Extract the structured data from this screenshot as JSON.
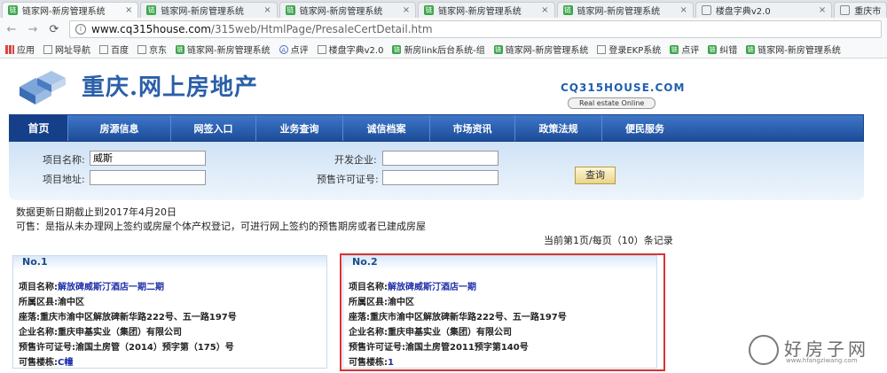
{
  "browser": {
    "tabs": [
      {
        "label": "链家网-新房管理系统",
        "icon": "green",
        "active": true
      },
      {
        "label": "链家网-新房管理系统",
        "icon": "green",
        "active": false
      },
      {
        "label": "链家网-新房管理系统",
        "icon": "green",
        "active": false
      },
      {
        "label": "链家网-新房管理系统",
        "icon": "green",
        "active": false
      },
      {
        "label": "链家网-新房管理系统",
        "icon": "green",
        "active": false
      },
      {
        "label": "楼盘字典v2.0",
        "icon": "doc",
        "active": false
      },
      {
        "label": "重庆市",
        "icon": "doc",
        "active": false
      }
    ],
    "url_host": "www.cq315house.com",
    "url_path": "/315web/HtmlPage/PresaleCertDetail.htm",
    "bookmarks": [
      {
        "label": "应用",
        "icon": "grid"
      },
      {
        "label": "网址导航",
        "icon": "doc"
      },
      {
        "label": "百度",
        "icon": "doc"
      },
      {
        "label": "京东",
        "icon": "doc"
      },
      {
        "label": "链家网-新房管理系统",
        "icon": "green"
      },
      {
        "label": "点评",
        "icon": "circle"
      },
      {
        "label": "楼盘字典v2.0",
        "icon": "doc"
      },
      {
        "label": "新房link后台系统-组",
        "icon": "green"
      },
      {
        "label": "链家网-新房管理系统",
        "icon": "green"
      },
      {
        "label": "登录EKP系统",
        "icon": "doc"
      },
      {
        "label": "点评",
        "icon": "green"
      },
      {
        "label": "纠错",
        "icon": "green"
      },
      {
        "label": "链家网-新房管理系统",
        "icon": "green"
      }
    ]
  },
  "site": {
    "title": "重庆.网上房地产",
    "brand": "CQ315HOUSE.COM",
    "brand_sub": "Real estate Online",
    "nav": [
      "首页",
      "房源信息",
      "网签入口",
      "业务查询",
      "诚信档案",
      "市场资讯",
      "政策法规",
      "便民服务"
    ]
  },
  "search": {
    "project_name_label": "项目名称:",
    "project_name_value": "威斯",
    "project_addr_label": "项目地址:",
    "project_addr_value": "",
    "developer_label": "开发企业:",
    "developer_value": "",
    "permit_label": "预售许可证号:",
    "permit_value": "",
    "button": "查询"
  },
  "info": {
    "update_line": "数据更新日期截止到2017年4月20日",
    "sale_note": "可售：是指从未办理网上签约或房屋个体产权登记，可进行网上签约的预售期房或者已建成房屋",
    "pager": "当前第1页/每页（10）条记录"
  },
  "results": [
    {
      "no": "No.1",
      "project_label": "项目名称:",
      "project": "解放碑威斯汀酒店一期二期",
      "district_label": "所属区县:",
      "district": "渝中区",
      "location_label": "座落:",
      "location": "重庆市渝中区解放碑新华路222号、五一路197号",
      "company_label": "企业名称:",
      "company": "重庆申基实业（集团）有限公司",
      "permit_label": "预售许可证号:",
      "permit": "渝国土房管（2014）预字第（175）号",
      "building_label": "可售楼栋:",
      "building": "C幢"
    },
    {
      "no": "No.2",
      "project_label": "项目名称:",
      "project": "解放碑威斯汀酒店一期",
      "district_label": "所属区县:",
      "district": "渝中区",
      "location_label": "座落:",
      "location": "重庆市渝中区解放碑新华路222号、五一路197号",
      "company_label": "企业名称:",
      "company": "重庆申基实业（集团）有限公司",
      "permit_label": "预售许可证号:",
      "permit": "渝国土房管2011预字第140号",
      "building_label": "可售楼栋:",
      "building": "1"
    }
  ],
  "watermark": {
    "text": "好房子网",
    "url": "www.hfangziwang.com"
  },
  "colors": {
    "nav_top": "#3f77c9",
    "nav_bottom": "#1c4c98",
    "link": "#1c2ea8",
    "highlight": "#d83333"
  }
}
